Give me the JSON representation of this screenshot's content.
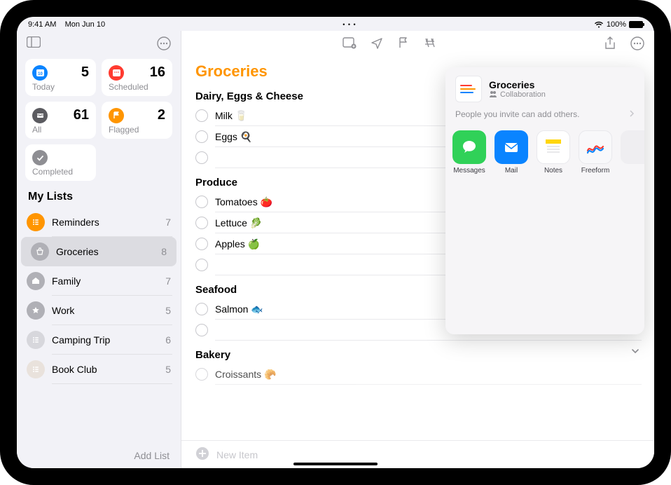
{
  "statusbar": {
    "time": "9:41 AM",
    "date": "Mon Jun 10",
    "battery": "100%"
  },
  "sidebar": {
    "smart": [
      {
        "label": "Today",
        "count": "5"
      },
      {
        "label": "Scheduled",
        "count": "16"
      },
      {
        "label": "All",
        "count": "61"
      },
      {
        "label": "Flagged",
        "count": "2"
      },
      {
        "label": "Completed",
        "count": ""
      }
    ],
    "lists_header": "My Lists",
    "lists": [
      {
        "label": "Reminders",
        "count": "7"
      },
      {
        "label": "Groceries",
        "count": "8"
      },
      {
        "label": "Family",
        "count": "7"
      },
      {
        "label": "Work",
        "count": "5"
      },
      {
        "label": "Camping Trip",
        "count": "6"
      },
      {
        "label": "Book Club",
        "count": "5"
      }
    ],
    "add_list": "Add List"
  },
  "main": {
    "title": "Groceries",
    "sections": [
      {
        "heading": "Dairy, Eggs & Cheese",
        "items": [
          "Milk 🥛",
          "Eggs 🍳"
        ]
      },
      {
        "heading": "Produce",
        "items": [
          "Tomatoes 🍅",
          "Lettuce 🥬",
          "Apples 🍏"
        ]
      },
      {
        "heading": "Seafood",
        "items": [
          "Salmon 🐟"
        ]
      },
      {
        "heading": "Bakery",
        "items": [
          "Croissants 🥐"
        ]
      }
    ],
    "new_item": "New Item"
  },
  "share": {
    "title": "Groceries",
    "subtitle": "Collaboration",
    "note": "People you invite can add others.",
    "apps": [
      "Messages",
      "Mail",
      "Notes",
      "Freeform"
    ]
  },
  "colors": {
    "accent": "#ff9500",
    "today": "#0a84ff",
    "scheduled": "#ff3b30",
    "all": "#5b5b60",
    "flagged": "#ff9500",
    "completed": "#8e8e93",
    "messages": "#30d158",
    "mail": "#0a84ff",
    "notes_bg": "#ffffff",
    "freeform": "#f2f2f7"
  }
}
